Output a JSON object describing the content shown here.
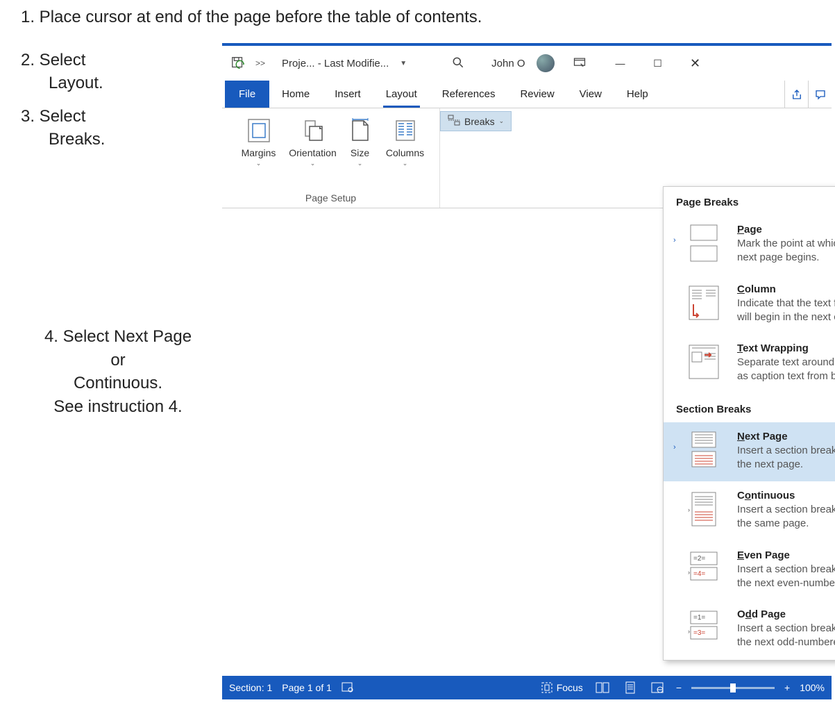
{
  "instructions": {
    "step1": "1. Place cursor at end of the page before the table of contents.",
    "step2a": "2. Select",
    "step2b": "Layout.",
    "step3a": "3. Select",
    "step3b": "Breaks.",
    "step4a": "4. Select Next Page",
    "step4b": "or",
    "step4c": "Continuous.",
    "step4d": "See instruction 4."
  },
  "titlebar": {
    "chevrons": ">>",
    "doc_title": "Proje...  - Last Modifie...",
    "username": "John O"
  },
  "tabs": {
    "file": "File",
    "home": "Home",
    "insert": "Insert",
    "layout": "Layout",
    "references": "References",
    "review": "Review",
    "view": "View",
    "help": "Help"
  },
  "page_setup": {
    "margins": "Margins",
    "orientation": "Orientation",
    "size": "Size",
    "columns": "Columns",
    "group_label": "Page Setup"
  },
  "breaks_button": "Breaks",
  "dropdown": {
    "page_breaks_header": "Page Breaks",
    "page": {
      "title": "Page",
      "desc": "Mark the point at which one page ends and the next page begins."
    },
    "column": {
      "title": "Column",
      "desc": "Indicate that the text following the column break will begin in the next column."
    },
    "text_wrapping": {
      "title": "Text Wrapping",
      "desc": "Separate text around objects on web pages, such as caption text from body text."
    },
    "section_breaks_header": "Section Breaks",
    "next_page": {
      "title": "Next Page",
      "desc": "Insert a section break and start the new section on the next page."
    },
    "continuous": {
      "title": "Continuous",
      "desc": "Insert a section break and start the new section on the same page."
    },
    "even_page": {
      "title": "Even Page",
      "desc": "Insert a section break and start the new section on the next even-numbered page."
    },
    "odd_page": {
      "title": "Odd Page",
      "desc": "Insert a section break and start the new section on the next odd-numbered page."
    }
  },
  "statusbar": {
    "section": "Section: 1",
    "page": "Page 1 of 1",
    "focus": "Focus",
    "zoom": "100%",
    "minus": "−",
    "plus": "+"
  }
}
